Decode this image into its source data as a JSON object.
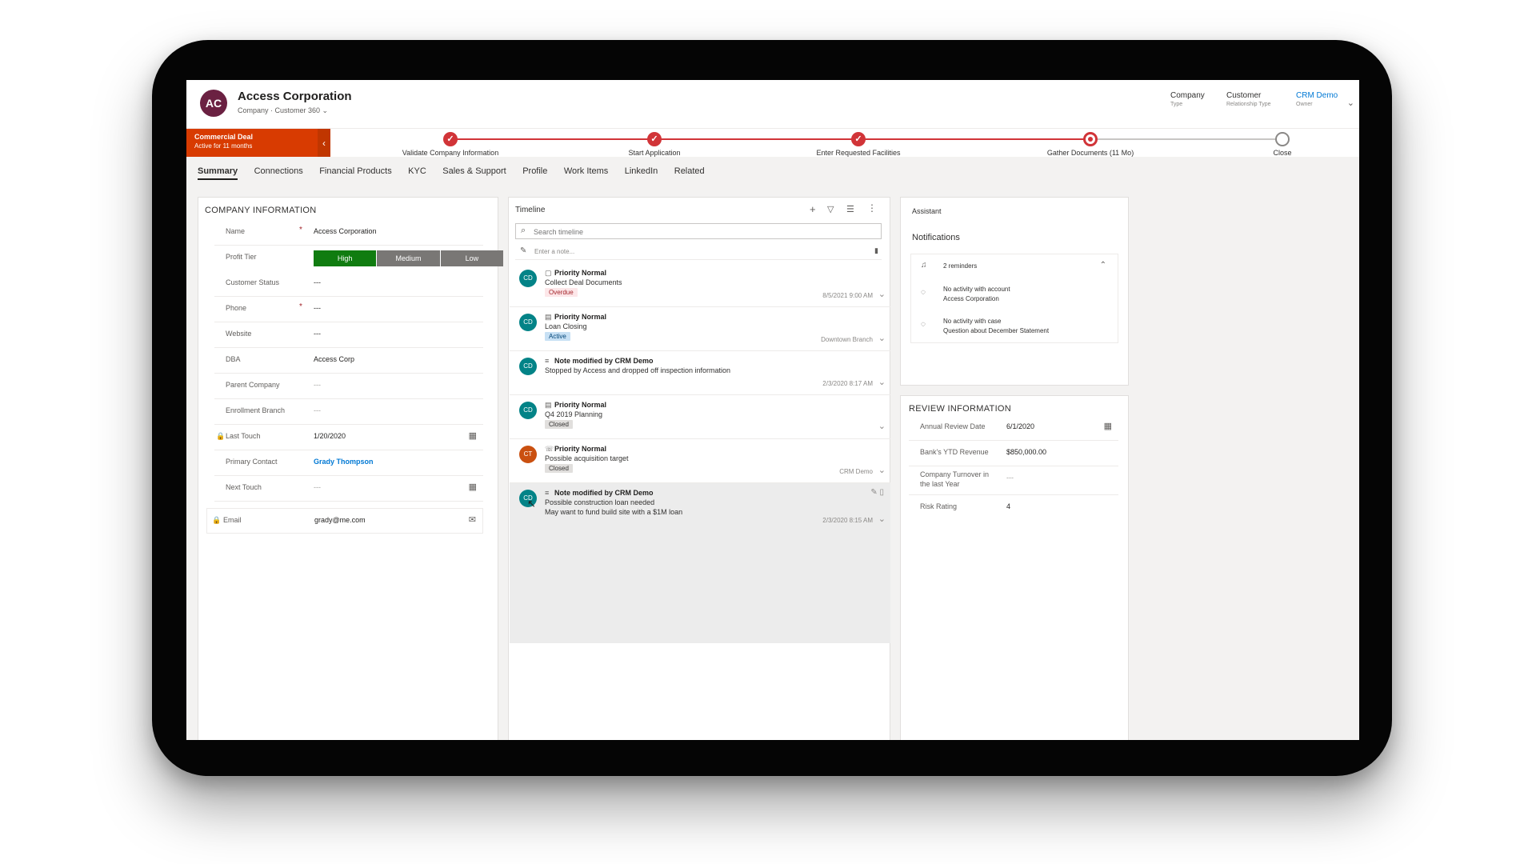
{
  "header": {
    "avatar_initials": "AC",
    "title": "Access Corporation",
    "subtitle": "Company · Customer 360 ⌄",
    "fields": [
      {
        "value": "Company",
        "label": "Type"
      },
      {
        "value": "Customer",
        "label": "Relationship Type"
      },
      {
        "value": "CRM Demo",
        "label": "Owner"
      }
    ]
  },
  "bpf": {
    "active_stage_name": "Commercial Deal",
    "active_duration": "Active for 11 months",
    "stages": [
      {
        "label": "Validate Company Information",
        "state": "done"
      },
      {
        "label": "Start Application",
        "state": "done"
      },
      {
        "label": "Enter Requested Facilities",
        "state": "done"
      },
      {
        "label": "Gather Documents (11 Mo)",
        "state": "active"
      },
      {
        "label": "Close",
        "state": "pending"
      }
    ]
  },
  "tabs": [
    "Summary",
    "Connections",
    "Financial Products",
    "KYC",
    "Sales & Support",
    "Profile",
    "Work Items",
    "LinkedIn",
    "Related"
  ],
  "company_info": {
    "title": "COMPANY INFORMATION",
    "fields": {
      "name": {
        "label": "Name",
        "value": "Access Corporation"
      },
      "profit_tier": {
        "label": "Profit Tier",
        "options": [
          "High",
          "Medium",
          "Low"
        ],
        "selected": "High"
      },
      "customer_status": {
        "label": "Customer Status",
        "value": "---"
      },
      "phone": {
        "label": "Phone",
        "value": "---"
      },
      "website": {
        "label": "Website",
        "value": "---"
      },
      "dba": {
        "label": "DBA",
        "value": "Access Corp"
      },
      "parent_company": {
        "label": "Parent Company",
        "value": "---"
      },
      "enrollment_branch": {
        "label": "Enrollment Branch",
        "value": "---"
      },
      "last_touch": {
        "label": "Last Touch",
        "value": "1/20/2020"
      },
      "primary_contact": {
        "label": "Primary Contact",
        "value": "Grady Thompson"
      },
      "next_touch": {
        "label": "Next Touch",
        "value": "---"
      },
      "email": {
        "label": "Email",
        "value": "grady@me.com"
      }
    }
  },
  "timeline": {
    "title": "Timeline",
    "search_placeholder": "Search timeline",
    "note_placeholder": "Enter a note...",
    "items": [
      {
        "initials": "CD",
        "title": "Priority Normal",
        "desc": "Collect Deal Documents",
        "badge": "Overdue",
        "meta": "8/5/2021 9:00 AM"
      },
      {
        "initials": "CD",
        "title": "Priority Normal",
        "desc": "Loan Closing",
        "badge": "Active",
        "meta": "Downtown Branch"
      },
      {
        "initials": "CD",
        "title": "Note modified by CRM Demo",
        "desc": "Stopped by Access and dropped off inspection information",
        "badge": "",
        "meta": "2/3/2020 8:17 AM"
      },
      {
        "initials": "CD",
        "title": "Priority Normal",
        "desc": "Q4 2019 Planning",
        "badge": "Closed",
        "meta": ""
      },
      {
        "initials": "CT",
        "title": "Priority Normal",
        "desc": "Possible acquisition target",
        "badge": "Closed",
        "meta": "CRM Demo"
      },
      {
        "initials": "CD",
        "title": "Note modified by CRM Demo",
        "desc": "Possible construction loan needed",
        "desc2": "May want to fund build site with a $1M loan",
        "badge": "",
        "meta": "2/3/2020 8:15 AM"
      }
    ]
  },
  "assistant": {
    "title": "Assistant",
    "notifications_title": "Notifications",
    "group_label": "2 reminders",
    "items": [
      {
        "line1": "No activity with account",
        "line2": "Access Corporation"
      },
      {
        "line1": "No activity with case",
        "line2": "Question about December Statement"
      }
    ]
  },
  "review_info": {
    "title": "REVIEW INFORMATION",
    "fields": [
      {
        "label": "Annual Review Date",
        "value": "6/1/2020"
      },
      {
        "label": "Bank's YTD Revenue",
        "value": "$850,000.00"
      },
      {
        "label": "Company Turnover in the last Year",
        "value": "---"
      },
      {
        "label": "Risk Rating",
        "value": "4"
      }
    ]
  },
  "colors": {
    "accent_red": "#d13438",
    "stage_orange": "#d83b01",
    "tier_high": "#107c10",
    "tier_other": "#797775",
    "link_blue": "#0078d4",
    "avatar_plum": "#6b2142",
    "teal": "#038387"
  }
}
